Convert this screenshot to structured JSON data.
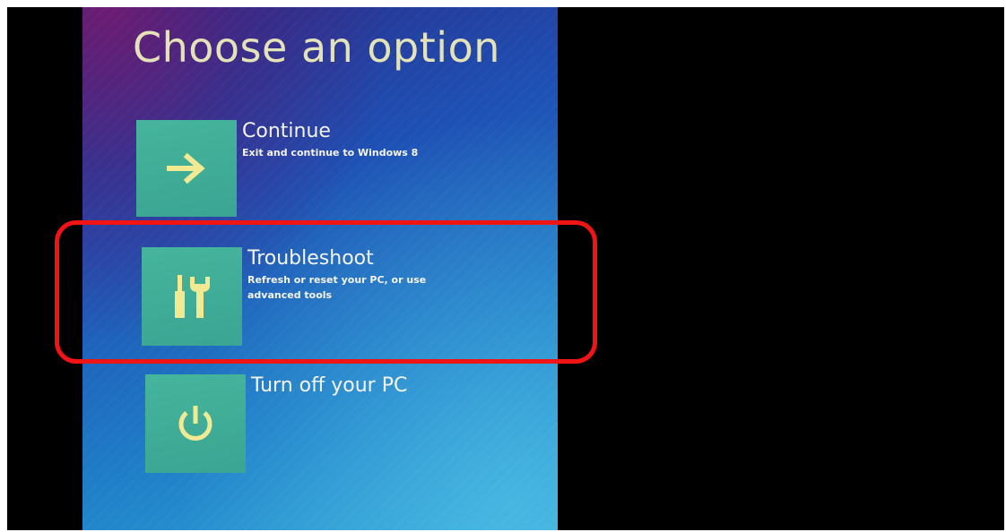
{
  "screen": {
    "title": "Choose an option"
  },
  "options": [
    {
      "label": "Continue",
      "description": "Exit and continue to Windows 8",
      "icon": "arrow-right-icon"
    },
    {
      "label": "Troubleshoot",
      "description_line1": "Refresh or reset your PC, or use",
      "description_line2": "advanced tools",
      "icon": "tools-icon"
    },
    {
      "label": "Turn off your PC",
      "icon": "power-icon"
    }
  ],
  "colors": {
    "tile": "#3fae96",
    "icon": "#f2ea92",
    "title_text": "#e4e2b8",
    "highlight": "#f01414",
    "background_outer": "#000000"
  }
}
